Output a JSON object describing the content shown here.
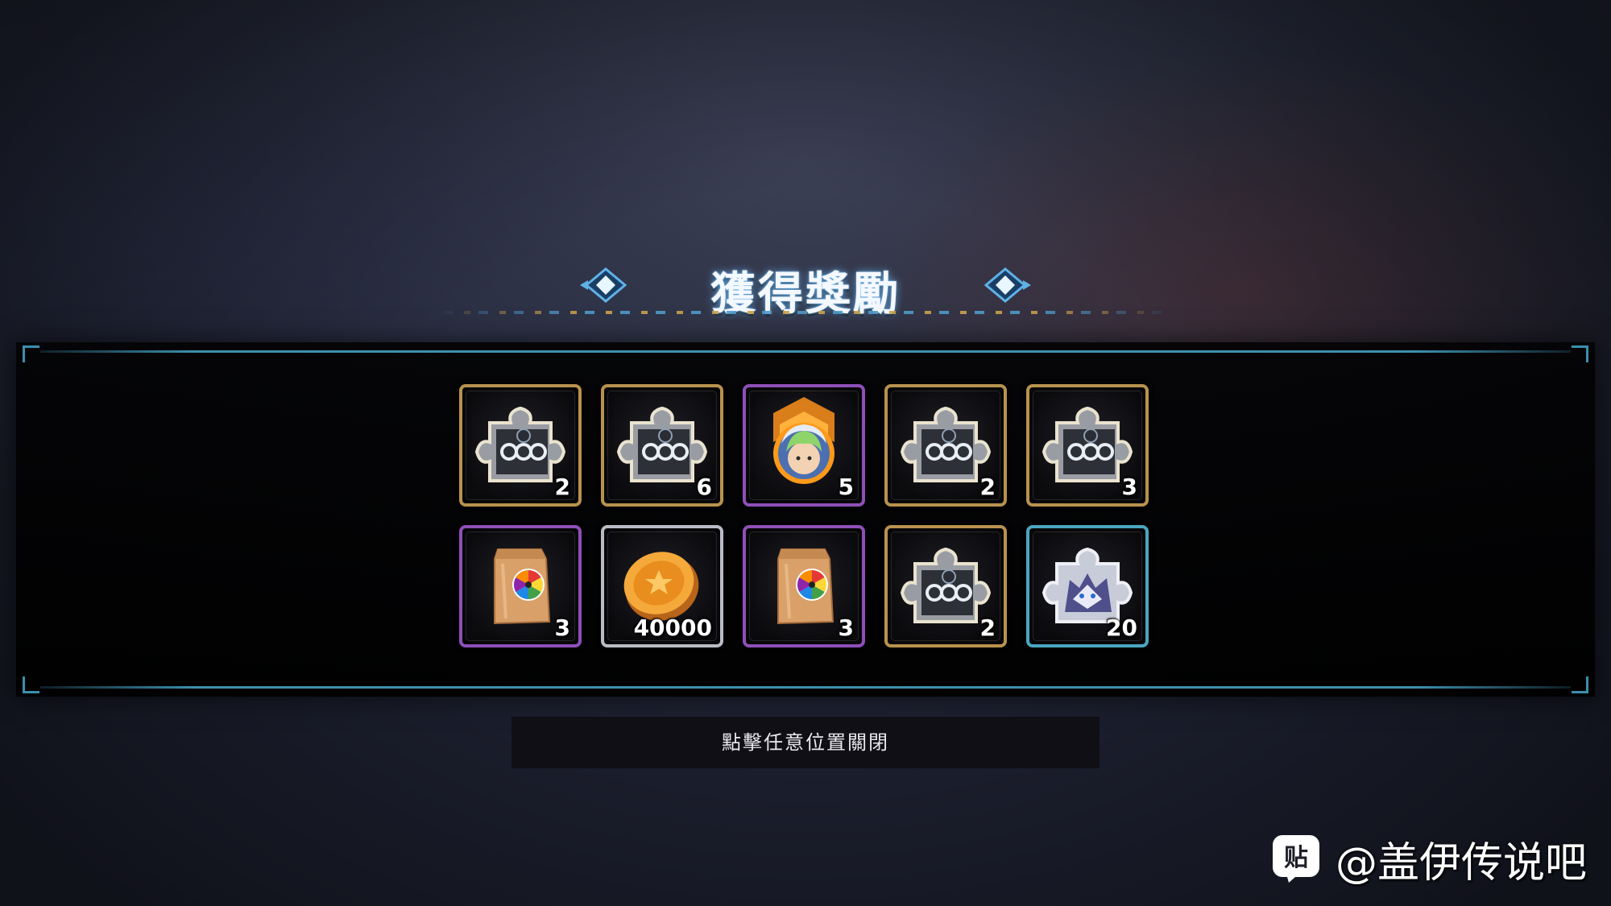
{
  "title": "獲得獎勵",
  "rewards": [
    {
      "item": "puzzle-piece-shadow",
      "count": "2",
      "rarity": "gold"
    },
    {
      "item": "puzzle-piece-shadow",
      "count": "6",
      "rarity": "gold"
    },
    {
      "item": "hero-portrait-rank-badge",
      "count": "5",
      "rarity": "purple"
    },
    {
      "item": "puzzle-piece-shadow",
      "count": "2",
      "rarity": "gold"
    },
    {
      "item": "puzzle-piece-shadow",
      "count": "3",
      "rarity": "gold"
    },
    {
      "item": "color-wheel-bag",
      "count": "3",
      "rarity": "purple"
    },
    {
      "item": "gold-coin",
      "count": "40000",
      "rarity": "silver"
    },
    {
      "item": "color-wheel-bag",
      "count": "3",
      "rarity": "purple"
    },
    {
      "item": "puzzle-piece-shadow",
      "count": "2",
      "rarity": "gold"
    },
    {
      "item": "puzzle-piece-wolf",
      "count": "20",
      "rarity": "cyan"
    }
  ],
  "close_hint": "點擊任意位置關閉",
  "watermark": {
    "logo_text": "贴",
    "text": "@盖伊传说吧"
  },
  "colors": {
    "frame_gold": "#b8924e",
    "frame_purple": "#8e4fb8",
    "frame_silver": "#b9bcc4",
    "frame_cyan": "#4aa6c0",
    "panel_line": "#3b8fae",
    "title_glow": "#6ebeff"
  }
}
